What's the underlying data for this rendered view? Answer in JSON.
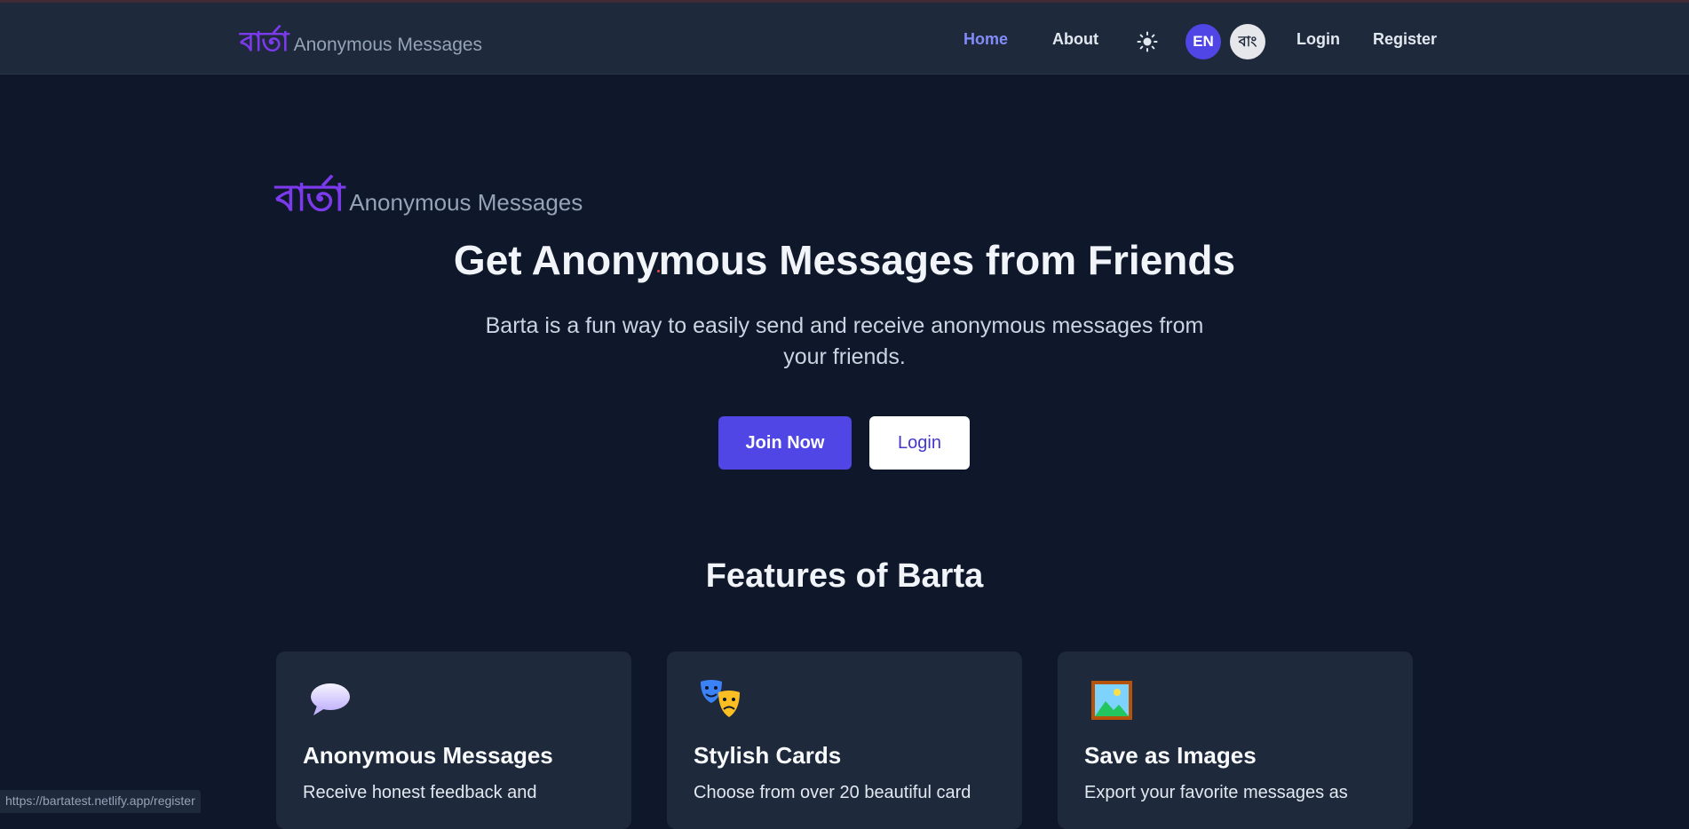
{
  "brand": {
    "bengali": "বার্তা",
    "subtitle": "Anonymous Messages"
  },
  "nav": {
    "home": "Home",
    "about": "About",
    "theme_icon": "sun-icon",
    "lang_en": "EN",
    "lang_bn": "বাং",
    "login": "Login",
    "register": "Register"
  },
  "hero": {
    "title": "Get Anonymous Messages from Friends",
    "description": "Barta is a fun way to easily send and receive anonymous messages from your friends.",
    "join_button": "Join Now",
    "login_button": "Login"
  },
  "features": {
    "title": "Features of Barta",
    "cards": [
      {
        "icon": "speech-bubble-icon",
        "title": "Anonymous Messages",
        "description": "Receive honest feedback and"
      },
      {
        "icon": "theater-masks-icon",
        "title": "Stylish Cards",
        "description": "Choose from over 20 beautiful card"
      },
      {
        "icon": "framed-picture-icon",
        "title": "Save as Images",
        "description": "Export your favorite messages as"
      }
    ]
  },
  "status_bar": {
    "url": "https://bartatest.netlify.app/register"
  },
  "colors": {
    "background": "#0f172a",
    "surface": "#1e293b",
    "accent": "#4f46e5",
    "logo": "#7c3aed",
    "active_link": "#818cf8"
  }
}
